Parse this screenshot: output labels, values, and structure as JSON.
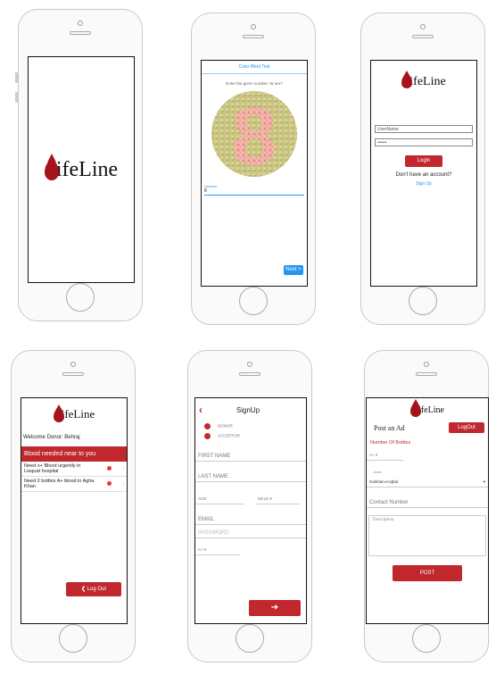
{
  "brand": {
    "logo_text": "ifeLine",
    "accent": "#c0282e"
  },
  "splash": {
    "logo_text": "ifeLine"
  },
  "colorblind": {
    "title": "Color Blind Test",
    "prompt": "Enter the given number. W are?",
    "plate_number": "8",
    "input_label": "Number",
    "input_value": "8",
    "next_label": "Next >"
  },
  "login": {
    "logo_text": "ifeLine",
    "username_placeholder": "UserName",
    "password_value": "••••••",
    "login_label": "Login",
    "no_account_text": "Don't have an account?",
    "signup_label": "Sign Up"
  },
  "donor_home": {
    "logo_text": "ifeLine",
    "welcome": "Welcome Donor: Behraj",
    "banner": "Blood needed near to you",
    "items": [
      {
        "text": "Need o+ Blood urgently in Liaquat hospital"
      },
      {
        "text": "Need 2 bottles A+ blood in Agha Khan"
      }
    ],
    "logout_label": "Log Out"
  },
  "signup": {
    "back_icon": "chevron-left-icon",
    "title": "SignUp",
    "role_options": [
      "DONOR",
      "ACCEPTOR"
    ],
    "first_name": "FIRST NAME",
    "last_name": "LAST NAME",
    "age": "AGE",
    "gender_value": "MALE",
    "email": "EMAIL",
    "password": "PASSWORD",
    "blood_group_value": "A+",
    "submit_icon": "arrow-right-icon"
  },
  "post_ad": {
    "logo_text": "ifeLine",
    "title": "Post an Ad",
    "logout_label": "LogOut",
    "bottles_label": "Number Of Bottles",
    "blood_group_value": "A+",
    "area_label": "Area",
    "area_value": "Gulshan-e-Iqbal",
    "contact_placeholder": "Contact Number",
    "description_placeholder": "Description",
    "post_label": "POST"
  }
}
